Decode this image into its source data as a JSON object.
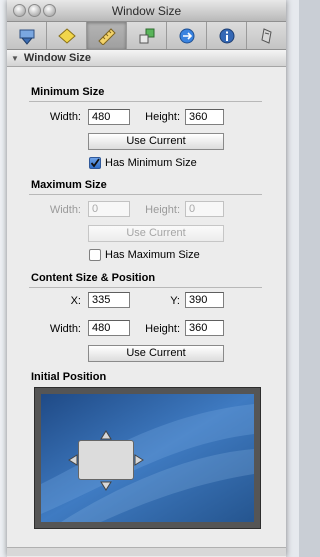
{
  "window": {
    "title": "Window Size"
  },
  "toolbar": {
    "tabs": [
      {
        "icon": "window-icon"
      },
      {
        "icon": "diamond-icon"
      },
      {
        "icon": "ruler-icon",
        "active": true
      },
      {
        "icon": "connections-icon"
      },
      {
        "icon": "arrow-circle-icon"
      },
      {
        "icon": "info-icon"
      },
      {
        "icon": "inspector-icon"
      }
    ]
  },
  "panel": {
    "header": "Window Size"
  },
  "minimum": {
    "title": "Minimum Size",
    "width_label": "Width:",
    "width_value": "480",
    "height_label": "Height:",
    "height_value": "360",
    "use_current": "Use Current",
    "checkbox_label": "Has Minimum Size",
    "checked": true
  },
  "maximum": {
    "title": "Maximum Size",
    "width_label": "Width:",
    "width_value": "0",
    "height_label": "Height:",
    "height_value": "0",
    "use_current": "Use Current",
    "checkbox_label": "Has Maximum Size",
    "checked": false
  },
  "content": {
    "title": "Content Size & Position",
    "x_label": "X:",
    "x_value": "335",
    "y_label": "Y:",
    "y_value": "390",
    "width_label": "Width:",
    "width_value": "480",
    "height_label": "Height:",
    "height_value": "360",
    "use_current": "Use Current"
  },
  "initial_position": {
    "title": "Initial Position"
  },
  "colors": {
    "checkbox_accent": "#2f6fc9",
    "preview_bg": "#2c5f9e"
  }
}
